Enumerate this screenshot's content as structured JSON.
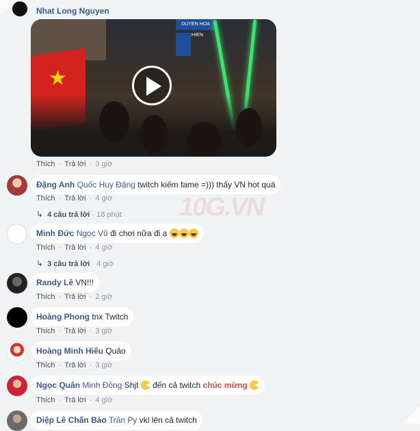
{
  "post": {
    "author": "Nhat Long Nguyen",
    "video_play_label": "",
    "actions": {
      "like": "Thích",
      "reply": "Trả lời",
      "time": "3 giờ"
    }
  },
  "watermark": "10G.VN",
  "comments": [
    {
      "author": "Đặng Anh",
      "parts": [
        {
          "t": "mention",
          "v": "Quốc Huy Đặng"
        },
        {
          "t": "text",
          "v": " twitch kiếm fame =))) thấy VN hot quá"
        }
      ],
      "actions": {
        "like": "Thích",
        "reply": "Trả lời",
        "time": "4 giờ"
      },
      "replies": {
        "label": "4 câu trả lời",
        "time": "18 phút"
      }
    },
    {
      "author": "Minh Đức",
      "parts": [
        {
          "t": "mention",
          "v": "Ngọc Vũ"
        },
        {
          "t": "text",
          "v": " đi chơi nữa đi ạ "
        }
      ],
      "emojis": [
        "laugh",
        "laugh",
        "laugh"
      ],
      "actions": {
        "like": "Thích",
        "reply": "Trả lời",
        "time": "4 giờ"
      },
      "replies": {
        "label": "3 câu trả lời",
        "time": "4 giờ"
      }
    },
    {
      "author": "Randy Lê",
      "parts": [
        {
          "t": "text",
          "v": " VN!!!"
        }
      ],
      "actions": {
        "like": "Thích",
        "reply": "Trả lời",
        "time": "2 giờ"
      }
    },
    {
      "author": "Hoàng Phong",
      "parts": [
        {
          "t": "text",
          "v": " tnx Twitch"
        }
      ],
      "actions": {
        "like": "Thích",
        "reply": "Trả lời",
        "time": "3 giờ"
      }
    },
    {
      "author": "Hoàng Minh Hiếu",
      "parts": [
        {
          "t": "text",
          "v": " Quảo"
        }
      ],
      "actions": {
        "like": "Thích",
        "reply": "Trả lời",
        "time": "3 giờ"
      }
    },
    {
      "author": "Ngọc Quân",
      "parts": [
        {
          "t": "mention",
          "v": "Minh Đồng"
        },
        {
          "t": "text",
          "v": " Shjt "
        },
        {
          "t": "emoji",
          "v": "pac"
        },
        {
          "t": "text",
          "v": " đến cả twitch "
        },
        {
          "t": "hl",
          "v": "chúc mừng"
        },
        {
          "t": "text",
          "v": " "
        },
        {
          "t": "emoji",
          "v": "pac"
        }
      ],
      "actions": {
        "like": "Thích",
        "reply": "Trả lời",
        "time": "4 giờ"
      }
    },
    {
      "author": "Diệp Lê Chấn Bảo",
      "parts": [
        {
          "t": "mention",
          "v": "Trần Py"
        },
        {
          "t": "text",
          "v": " vkl lên cả twitch"
        }
      ]
    }
  ]
}
